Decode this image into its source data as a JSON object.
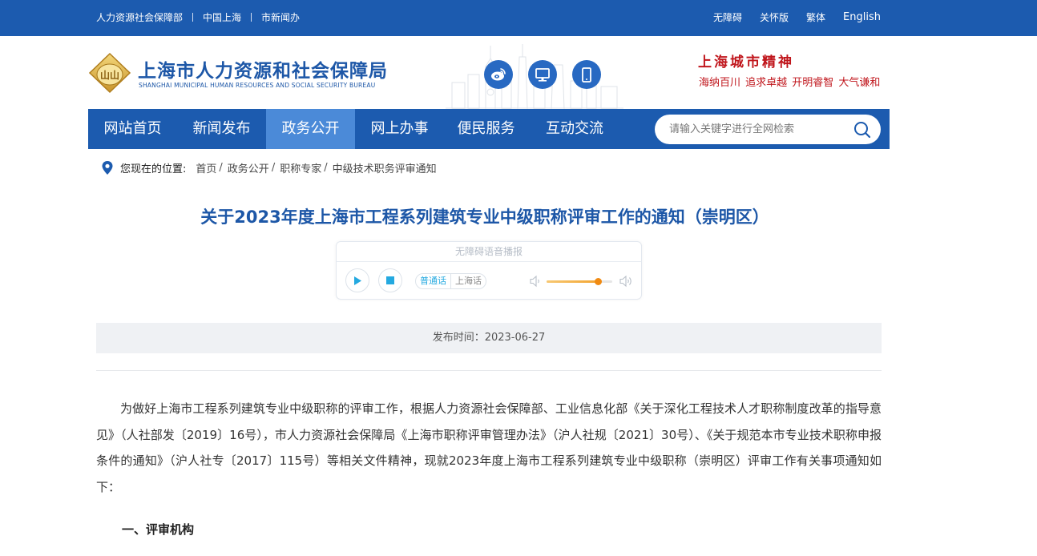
{
  "topbar": {
    "links": [
      "人力资源社会保障部",
      "中国上海",
      "市新闻办"
    ],
    "tools": [
      "无障碍",
      "关怀版",
      "繁体",
      "English"
    ]
  },
  "header": {
    "site_name": "上海市人力资源和社会保障局",
    "site_name_en": "SHANGHAI MUNICIPAL HUMAN RESOURCES AND SOCIAL SECURITY BUREAU",
    "emblem_text": "山山",
    "social_icons": [
      "weibo-icon",
      "desktop-icon",
      "mobile-icon"
    ],
    "spirit_title": "上海城市精神",
    "spirit_sub": "海纳百川  追求卓越  开明睿智  大气谦和"
  },
  "nav": {
    "items": [
      "网站首页",
      "新闻发布",
      "政务公开",
      "网上办事",
      "便民服务",
      "互动交流"
    ],
    "active": "政务公开",
    "search_placeholder": "请输入关键字进行全网检索"
  },
  "breadcrumb": {
    "label": "您现在的位置:",
    "items": [
      "首页",
      "政务公开",
      "职称专家",
      "中级技术职务评审通知"
    ]
  },
  "article": {
    "title": "关于2023年度上海市工程系列建筑专业中级职称评审工作的通知（崇明区）",
    "publish_time": "发布时间：2023-06-27",
    "paragraph": "为做好上海市工程系列建筑专业中级职称的评审工作，根据人力资源社会保障部、工业信息化部《关于深化工程技术人才职称制度改革的指导意见》（人社部发〔2019〕16号），市人力资源社会保障局《上海市职称评审管理办法》（沪人社规〔2021〕30号）、《关于规范本市专业技术职称申报条件的通知》（沪人社专〔2017〕115号）等相关文件精神，现就2023年度上海市工程系列建筑专业中级职称（崇明区）评审工作有关事项通知如下：",
    "section_1": "一、评审机构"
  },
  "player": {
    "title": "无障碍语音播报",
    "lang_active": "普通话",
    "lang_other": "上海话",
    "volume": 0.78,
    "colors": {
      "accent": "#24a9e0",
      "volume": "#f08a12"
    }
  },
  "colors": {
    "brand_blue": "#1c5baf",
    "nav_active": "#4b8ad8",
    "title_blue": "#1d57a7",
    "spirit_red": "#c0161c"
  }
}
